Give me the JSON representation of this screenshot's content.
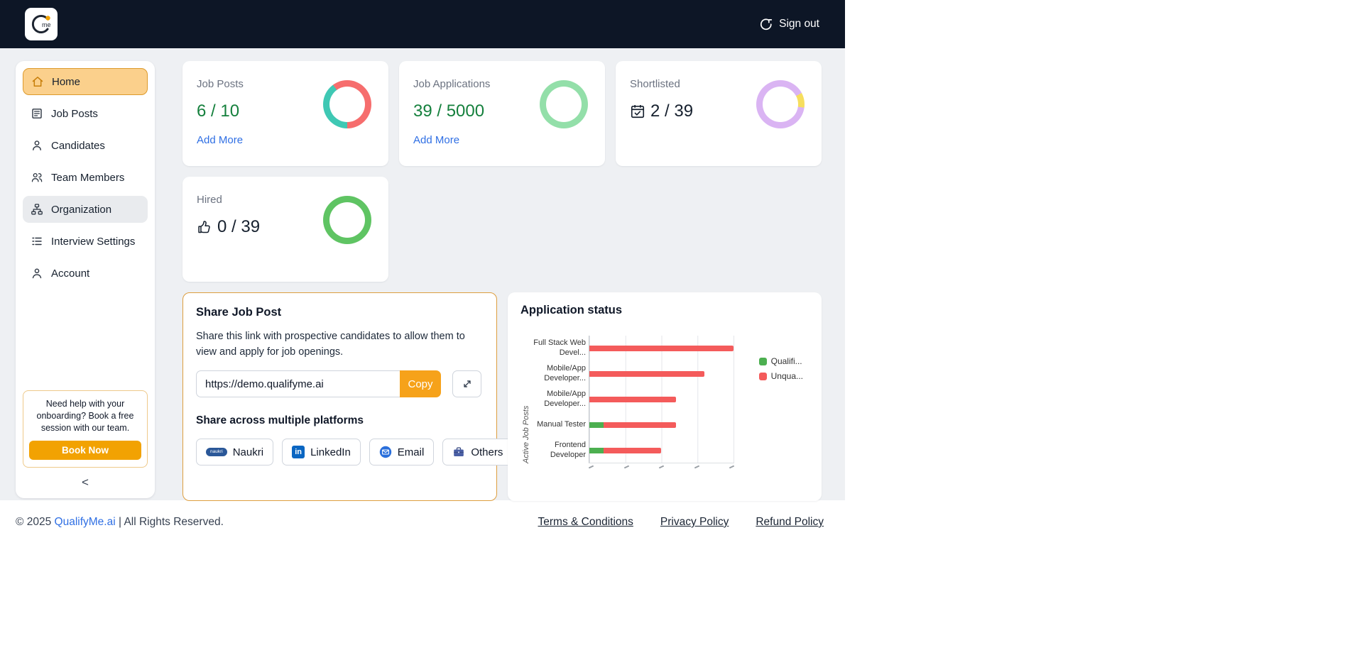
{
  "navbar": {
    "sign_out_label": "Sign out"
  },
  "logo": {
    "text": "me"
  },
  "sidebar": {
    "items": [
      {
        "label": "Home"
      },
      {
        "label": "Job Posts"
      },
      {
        "label": "Candidates"
      },
      {
        "label": "Team Members"
      },
      {
        "label": "Organization"
      },
      {
        "label": "Interview Settings"
      },
      {
        "label": "Account"
      }
    ],
    "help_text": "Need help with your onboarding? Book a free session with our team.",
    "book_now_label": "Book Now",
    "collapse_glyph": "<"
  },
  "stats": [
    {
      "title": "Job Posts",
      "value": "6 / 10",
      "link_label": "Add More",
      "ring": {
        "start": 180,
        "segments": [
          {
            "color": "#3fc8b4",
            "pct": 40
          },
          {
            "color": "#f66d6d",
            "pct": 60
          }
        ]
      }
    },
    {
      "title": "Job Applications",
      "value": "39 / 5000",
      "link_label": "Add More",
      "ring": {
        "start": 0,
        "segments": [
          {
            "color": "#93dfa9",
            "pct": 100
          }
        ]
      }
    },
    {
      "title": "Shortlisted",
      "value": "2 / 39",
      "icon": "calendar-check-icon",
      "ring": {
        "start": 62,
        "segments": [
          {
            "color": "#f6de5e",
            "pct": 10
          },
          {
            "color": "#dab4f3",
            "pct": 90
          }
        ]
      }
    },
    {
      "title": "Hired",
      "value": "0 / 39",
      "icon": "thumbs-up-icon",
      "ring": {
        "start": 0,
        "segments": [
          {
            "color": "#5fc463",
            "pct": 100
          }
        ]
      }
    }
  ],
  "share": {
    "title": "Share Job Post",
    "description": "Share this link with prospective candidates to allow them to view and apply for job openings.",
    "url": "https://demo.qualifyme.ai",
    "copy_label": "Copy",
    "platforms_title": "Share across multiple platforms",
    "platforms": [
      {
        "label": "Naukri",
        "icon": "naukri-icon"
      },
      {
        "label": "LinkedIn",
        "icon": "linkedin-icon"
      },
      {
        "label": "Email",
        "icon": "email-icon"
      },
      {
        "label": "Others",
        "icon": "briefcase-icon"
      }
    ]
  },
  "application_status": {
    "title": "Application status",
    "chart_data": {
      "type": "bar",
      "orientation": "horizontal",
      "stacked": true,
      "categories": [
        "Full Stack Web Devel...",
        "Mobile/App Developer...",
        "Mobile/App Developer...",
        "Manual Tester",
        "Frontend Developer"
      ],
      "series": [
        {
          "name": "Qualifi...",
          "color": "#4caf50",
          "values": [
            0,
            0,
            0,
            1,
            1
          ]
        },
        {
          "name": "Unqua...",
          "color": "#f45b5b",
          "values": [
            10,
            8,
            6,
            5,
            4
          ]
        }
      ],
      "ylabel": "Active Job Posts",
      "xlim": [
        0,
        10
      ],
      "grid": true,
      "legend_position": "top-right"
    }
  },
  "footer": {
    "copyright_prefix": "© 2025 ",
    "brand": "QualifyMe.ai",
    "copyright_suffix": " | All Rights Reserved.",
    "links": [
      "Terms & Conditions",
      "Privacy Policy",
      "Refund Policy"
    ]
  }
}
